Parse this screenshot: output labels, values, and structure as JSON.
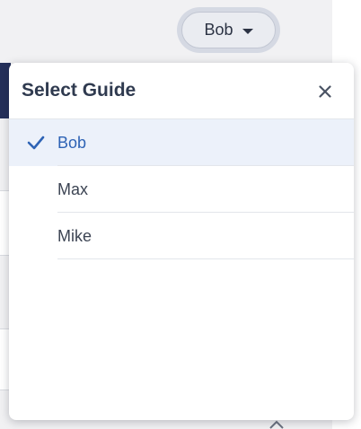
{
  "guide_selector": {
    "current": "Bob",
    "icon": "caret-down-icon"
  },
  "popover": {
    "title": "Select Guide",
    "close_icon": "close-icon",
    "options": [
      {
        "label": "Bob",
        "selected": true
      },
      {
        "label": "Max",
        "selected": false
      },
      {
        "label": "Mike",
        "selected": false
      }
    ],
    "check_icon": "check-icon"
  },
  "colors": {
    "accent": "#2e63b5",
    "selected_row": "#ecf1fa",
    "title_text": "#2f3a4f",
    "nav_dark": "#25305a"
  }
}
